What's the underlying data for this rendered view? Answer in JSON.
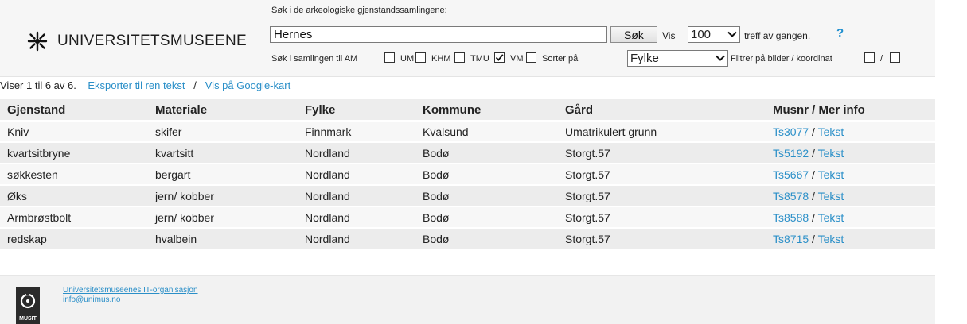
{
  "header": {
    "logo_text": "UNIVERSITETSMUSEENE",
    "search_caption": "Søk i de arkeologiske gjenstandssamlingene:",
    "search_value": "Hernes",
    "search_button": "Søk",
    "vis_label": "Vis",
    "vis_value": "100",
    "treff_label": "treff av gangen.",
    "help": "?",
    "filter_label": "Søk i samlingen til AM",
    "collections": [
      {
        "label": "UM",
        "checked": false
      },
      {
        "label": "KHM",
        "checked": false
      },
      {
        "label": "TMU",
        "checked": true
      },
      {
        "label": "VM",
        "checked": false
      }
    ],
    "sort_label": "Sorter på",
    "sort_value": "Fylke",
    "filter_images_label": "Filtrer på bilder / koordinat",
    "slash": "/"
  },
  "results": {
    "count_text": "Viser 1 til 6 av 6.",
    "export_link": "Eksporter til ren tekst",
    "separator": "/",
    "map_link": "Vis på Google-kart"
  },
  "table": {
    "headers": [
      "Gjenstand",
      "Materiale",
      "Fylke",
      "Kommune",
      "Gård",
      "Musnr / Mer info"
    ],
    "rows": [
      {
        "gjenstand": "Kniv",
        "materiale": "skifer",
        "fylke": "Finnmark",
        "kommune": "Kvalsund",
        "gard": "Umatrikulert grunn",
        "musnr": "Ts3077",
        "info": "Tekst"
      },
      {
        "gjenstand": "kvartsitbryne",
        "materiale": "kvartsitt",
        "fylke": "Nordland",
        "kommune": "Bodø",
        "gard": "Storgt.57",
        "musnr": "Ts5192",
        "info": "Tekst"
      },
      {
        "gjenstand": "søkkesten",
        "materiale": "bergart",
        "fylke": "Nordland",
        "kommune": "Bodø",
        "gard": "Storgt.57",
        "musnr": "Ts5667",
        "info": "Tekst"
      },
      {
        "gjenstand": "Øks",
        "materiale": "jern/ kobber",
        "fylke": "Nordland",
        "kommune": "Bodø",
        "gard": "Storgt.57",
        "musnr": "Ts8578",
        "info": "Tekst"
      },
      {
        "gjenstand": "Armbrøstbolt",
        "materiale": "jern/ kobber",
        "fylke": "Nordland",
        "kommune": "Bodø",
        "gard": "Storgt.57",
        "musnr": "Ts8588",
        "info": "Tekst"
      },
      {
        "gjenstand": "redskap",
        "materiale": "hvalbein",
        "fylke": "Nordland",
        "kommune": "Bodø",
        "gard": "Storgt.57",
        "musnr": "Ts8715",
        "info": "Tekst"
      }
    ],
    "link_separator": "/"
  },
  "footer": {
    "org": "Universitetsmuseenes IT-organisasjon",
    "email": "info@unimus.no",
    "musit_label": "MUSIT"
  },
  "colors": {
    "link": "#2a8fc8",
    "help": "#1f8fcf",
    "header_bg": "#f6f6f6",
    "footer_bg": "#f2f2f2"
  }
}
